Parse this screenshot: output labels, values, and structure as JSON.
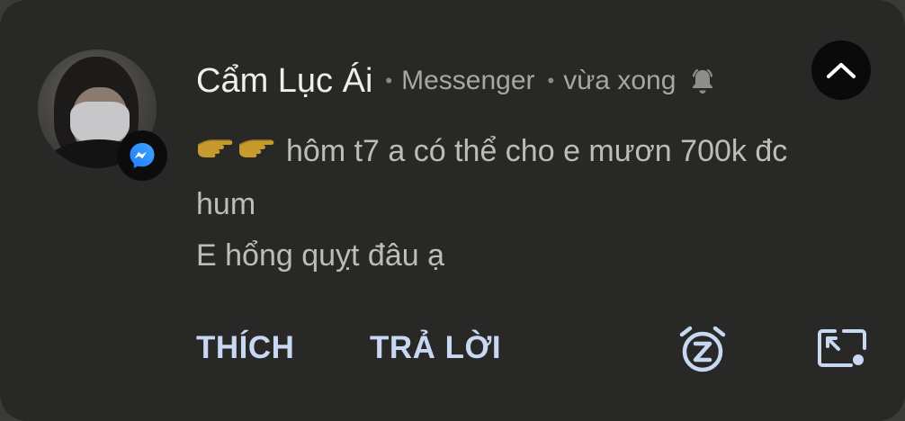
{
  "notification": {
    "sender": "Cẩm Lục Ái",
    "app": "Messenger",
    "time": "vừa xong",
    "message_lines": [
      "hôm t7 a có thể cho e mươn 700k đc",
      "hum",
      "E hổng quỵt đâu ạ"
    ],
    "icons": {
      "avatar": "contact-photo",
      "badge": "messenger-icon",
      "bell": "bell-icon",
      "collapse": "chevron-up-icon",
      "emoji": "backhand-index-pointing-right",
      "snooze": "snooze-alarm-icon",
      "pip": "picture-in-picture-icon"
    }
  },
  "actions": {
    "like_label": "THÍCH",
    "reply_label": "TRẢ LỜI"
  },
  "colors": {
    "card_bg": "#282826",
    "action_text": "#c8d8f2",
    "messenger_blue": "#2f8cff"
  }
}
